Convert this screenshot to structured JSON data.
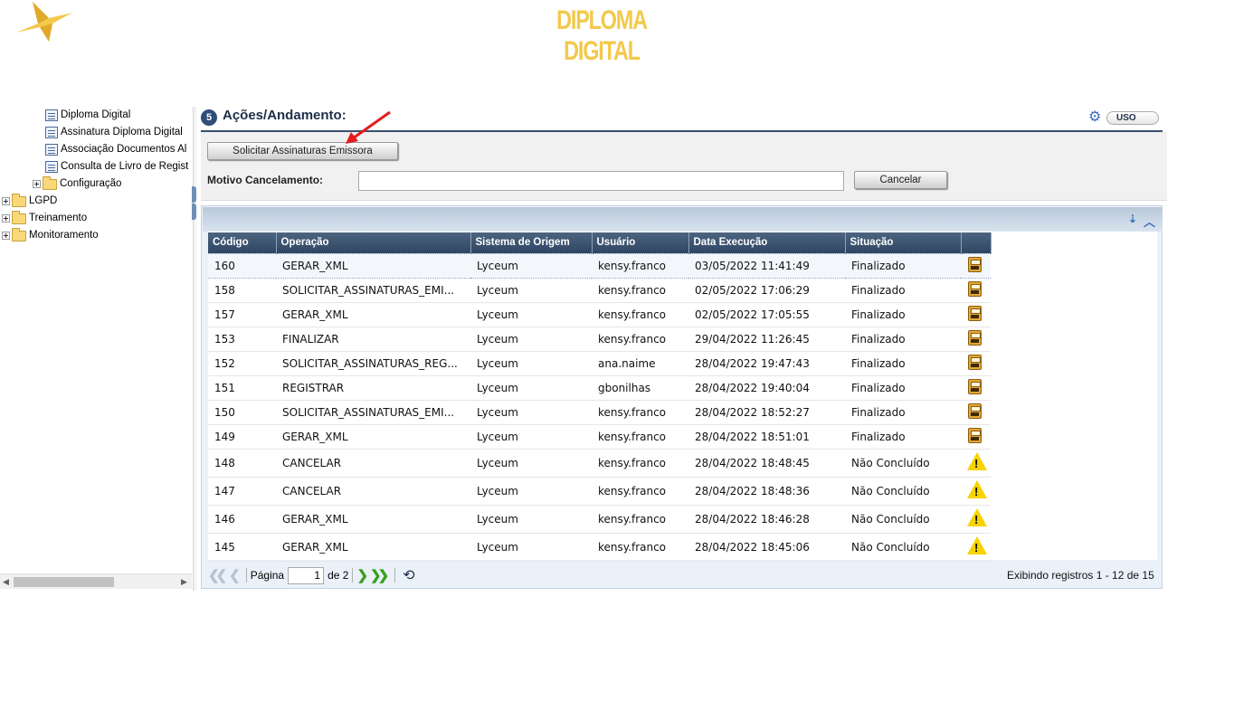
{
  "header": {
    "title": "DIPLOMA DIGITAL"
  },
  "tree": {
    "items": [
      {
        "label": "Diploma Digital"
      },
      {
        "label": "Assinatura Diploma Digital"
      },
      {
        "label": "Associação Documentos Al"
      },
      {
        "label": "Consulta de Livro de Regist"
      },
      {
        "label": "Configuração"
      },
      {
        "label": "LGPD"
      },
      {
        "label": "Treinamento"
      },
      {
        "label": "Monitoramento"
      }
    ]
  },
  "section": {
    "number": "5",
    "title": "Ações/Andamento:",
    "toggle_label": "USO"
  },
  "actions": {
    "solicitar_label": "Solicitar Assinaturas Emissora",
    "motivo_label": "Motivo Cancelamento:",
    "motivo_value": "",
    "cancelar_label": "Cancelar"
  },
  "grid": {
    "columns": [
      "Código",
      "Operação",
      "Sistema de Origem",
      "Usuário",
      "Data Execução",
      "Situação"
    ],
    "rows": [
      {
        "codigo": "160",
        "operacao": "GERAR_XML",
        "sistema": "Lyceum",
        "usuario": "kensy.franco",
        "data": "03/05/2022 11:41:49",
        "situacao": "Finalizado",
        "icon": "save-icon"
      },
      {
        "codigo": "158",
        "operacao": "SOLICITAR_ASSINATURAS_EMI...",
        "sistema": "Lyceum",
        "usuario": "kensy.franco",
        "data": "02/05/2022 17:06:29",
        "situacao": "Finalizado",
        "icon": "save-icon"
      },
      {
        "codigo": "157",
        "operacao": "GERAR_XML",
        "sistema": "Lyceum",
        "usuario": "kensy.franco",
        "data": "02/05/2022 17:05:55",
        "situacao": "Finalizado",
        "icon": "save-icon"
      },
      {
        "codigo": "153",
        "operacao": "FINALIZAR",
        "sistema": "Lyceum",
        "usuario": "kensy.franco",
        "data": "29/04/2022 11:26:45",
        "situacao": "Finalizado",
        "icon": "save-icon"
      },
      {
        "codigo": "152",
        "operacao": "SOLICITAR_ASSINATURAS_REG...",
        "sistema": "Lyceum",
        "usuario": "ana.naime",
        "data": "28/04/2022 19:47:43",
        "situacao": "Finalizado",
        "icon": "save-icon"
      },
      {
        "codigo": "151",
        "operacao": "REGISTRAR",
        "sistema": "Lyceum",
        "usuario": "gbonilhas",
        "data": "28/04/2022 19:40:04",
        "situacao": "Finalizado",
        "icon": "save-icon"
      },
      {
        "codigo": "150",
        "operacao": "SOLICITAR_ASSINATURAS_EMI...",
        "sistema": "Lyceum",
        "usuario": "kensy.franco",
        "data": "28/04/2022 18:52:27",
        "situacao": "Finalizado",
        "icon": "save-icon"
      },
      {
        "codigo": "149",
        "operacao": "GERAR_XML",
        "sistema": "Lyceum",
        "usuario": "kensy.franco",
        "data": "28/04/2022 18:51:01",
        "situacao": "Finalizado",
        "icon": "save-icon"
      },
      {
        "codigo": "148",
        "operacao": "CANCELAR",
        "sistema": "Lyceum",
        "usuario": "kensy.franco",
        "data": "28/04/2022 18:48:45",
        "situacao": "Não Concluído",
        "icon": "warning-icon"
      },
      {
        "codigo": "147",
        "operacao": "CANCELAR",
        "sistema": "Lyceum",
        "usuario": "kensy.franco",
        "data": "28/04/2022 18:48:36",
        "situacao": "Não Concluído",
        "icon": "warning-icon"
      },
      {
        "codigo": "146",
        "operacao": "GERAR_XML",
        "sistema": "Lyceum",
        "usuario": "kensy.franco",
        "data": "28/04/2022 18:46:28",
        "situacao": "Não Concluído",
        "icon": "warning-icon"
      },
      {
        "codigo": "145",
        "operacao": "GERAR_XML",
        "sistema": "Lyceum",
        "usuario": "kensy.franco",
        "data": "28/04/2022 18:45:06",
        "situacao": "Não Concluído",
        "icon": "warning-icon"
      }
    ]
  },
  "pager": {
    "page_label": "Página",
    "current_page": "1",
    "of_label": "de 2",
    "info": "Exibindo registros 1 - 12 de 15"
  },
  "colors": {
    "brand": "#f2c94c",
    "header_dark": "#2f4662",
    "warning": "#f7d300",
    "arrow_red": "#e41b1b"
  }
}
